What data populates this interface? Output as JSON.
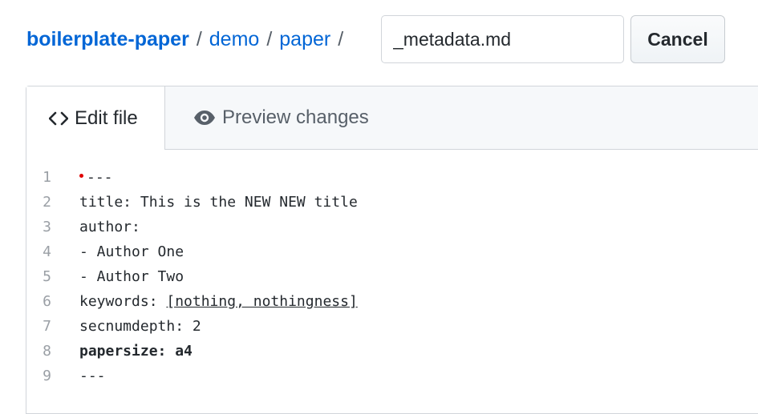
{
  "breadcrumb": {
    "repo": "boilerplate-paper",
    "separator": "/",
    "dir1": "demo",
    "dir2": "paper"
  },
  "filename": {
    "value": "_metadata.md"
  },
  "actions": {
    "cancel_label": "Cancel"
  },
  "tabs": {
    "edit": {
      "icon": "code-icon",
      "label": "Edit file"
    },
    "preview": {
      "icon": "eye-icon",
      "label": "Preview changes"
    }
  },
  "editor": {
    "modified_marker_color": "#e00000",
    "lines": [
      {
        "number": "1",
        "text": "---"
      },
      {
        "number": "2",
        "text": "title: This is the NEW NEW title"
      },
      {
        "number": "3",
        "text": "author:"
      },
      {
        "number": "4",
        "text": "- Author One"
      },
      {
        "number": "5",
        "text": "- Author Two"
      },
      {
        "number": "6",
        "key": "keywords: ",
        "value": "[nothing, nothingness]"
      },
      {
        "number": "7",
        "text": "secnumdepth: 2"
      },
      {
        "number": "8",
        "text": "papersize: a4"
      },
      {
        "number": "9",
        "text": "---"
      }
    ]
  },
  "colors": {
    "link": "#0366d6",
    "tab_bar_bg": "#f6f8fa",
    "border": "#d1d5da"
  }
}
